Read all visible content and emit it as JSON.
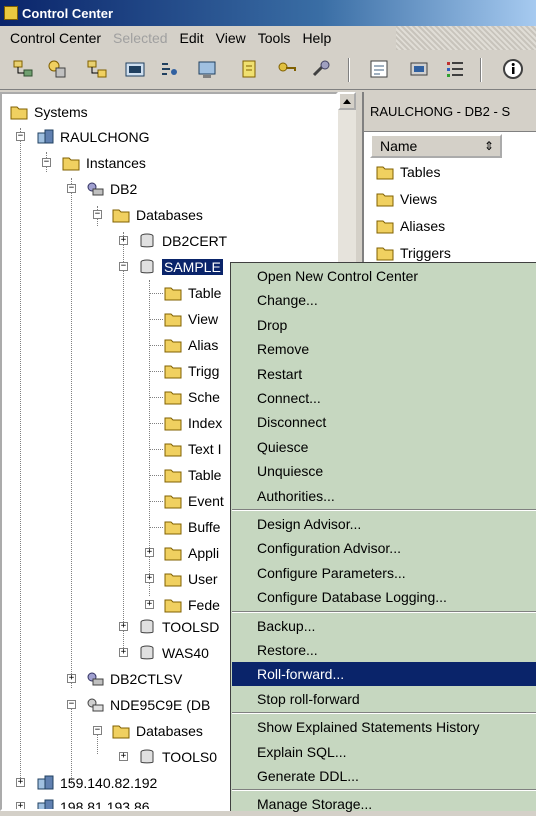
{
  "window": {
    "title": "Control Center"
  },
  "menu": [
    "Control Center",
    "Selected",
    "Edit",
    "View",
    "Tools",
    "Help"
  ],
  "toolbar": {
    "icons": [
      "systems-icon",
      "instances-icon",
      "databases-icon",
      "command-center-icon",
      "script-center-icon",
      "task-center-icon",
      "journal-icon",
      "license-center-icon",
      "tools-settings-icon",
      "replication-icon",
      "health-center-icon",
      "list-icon",
      "info-icon"
    ]
  },
  "tree": {
    "systems": "Systems",
    "raulchong": "RAULCHONG",
    "instances": "Instances",
    "db2": "DB2",
    "databases": "Databases",
    "db2cert": "DB2CERT",
    "sample": "SAMPLE",
    "children": [
      "Table",
      "View",
      "Alias",
      "Trigg",
      "Sche",
      "Index",
      "Text I",
      "Table",
      "Event",
      "Buffe",
      "Appli",
      "User",
      "Fede"
    ],
    "toolsd": "TOOLSD",
    "ws840": "WAS40",
    "db2ctlsv": "DB2CTLSV",
    "nde": "NDE95C9E (DB",
    "databases2": "Databases",
    "tools0": "TOOLS0",
    "ip1": "159.140.82.192",
    "ip2": "198.81.193.86"
  },
  "right": {
    "title": "RAULCHONG - DB2 - S",
    "column": "Name",
    "items": [
      "Tables",
      "Views",
      "Aliases",
      "Triggers"
    ]
  },
  "context_menu": [
    "Open New Control Center",
    "Change...",
    "Drop",
    "Remove",
    "Restart",
    "Connect...",
    "Disconnect",
    "Quiesce",
    "Unquiesce",
    "Authorities...",
    "Design Advisor...",
    "Configuration Advisor...",
    "Configure Parameters...",
    "Configure Database Logging...",
    "Backup...",
    "Restore...",
    "Roll-forward...",
    "Stop roll-forward",
    "Show Explained Statements History",
    "Explain SQL...",
    "Generate DDL...",
    "Manage Storage..."
  ],
  "colors": {
    "selection": "#0a246a",
    "menu_bg": "#c6d7c0",
    "folder": "#f0d060"
  }
}
